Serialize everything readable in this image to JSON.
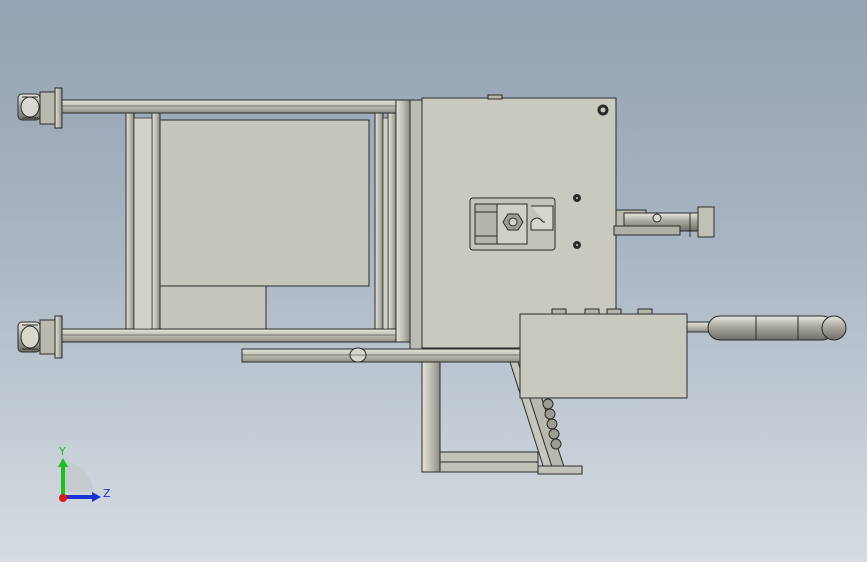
{
  "triad": {
    "y_label": "Y",
    "z_label": "Z",
    "y_color": "#16c21b",
    "z_color": "#1b33d6",
    "x_color": "#e01818"
  },
  "colors": {
    "background_top": "#94a3b3",
    "background_bottom": "#d6dce2",
    "part_fill": "#c9c9bf",
    "part_edge": "#2b2b2b"
  }
}
